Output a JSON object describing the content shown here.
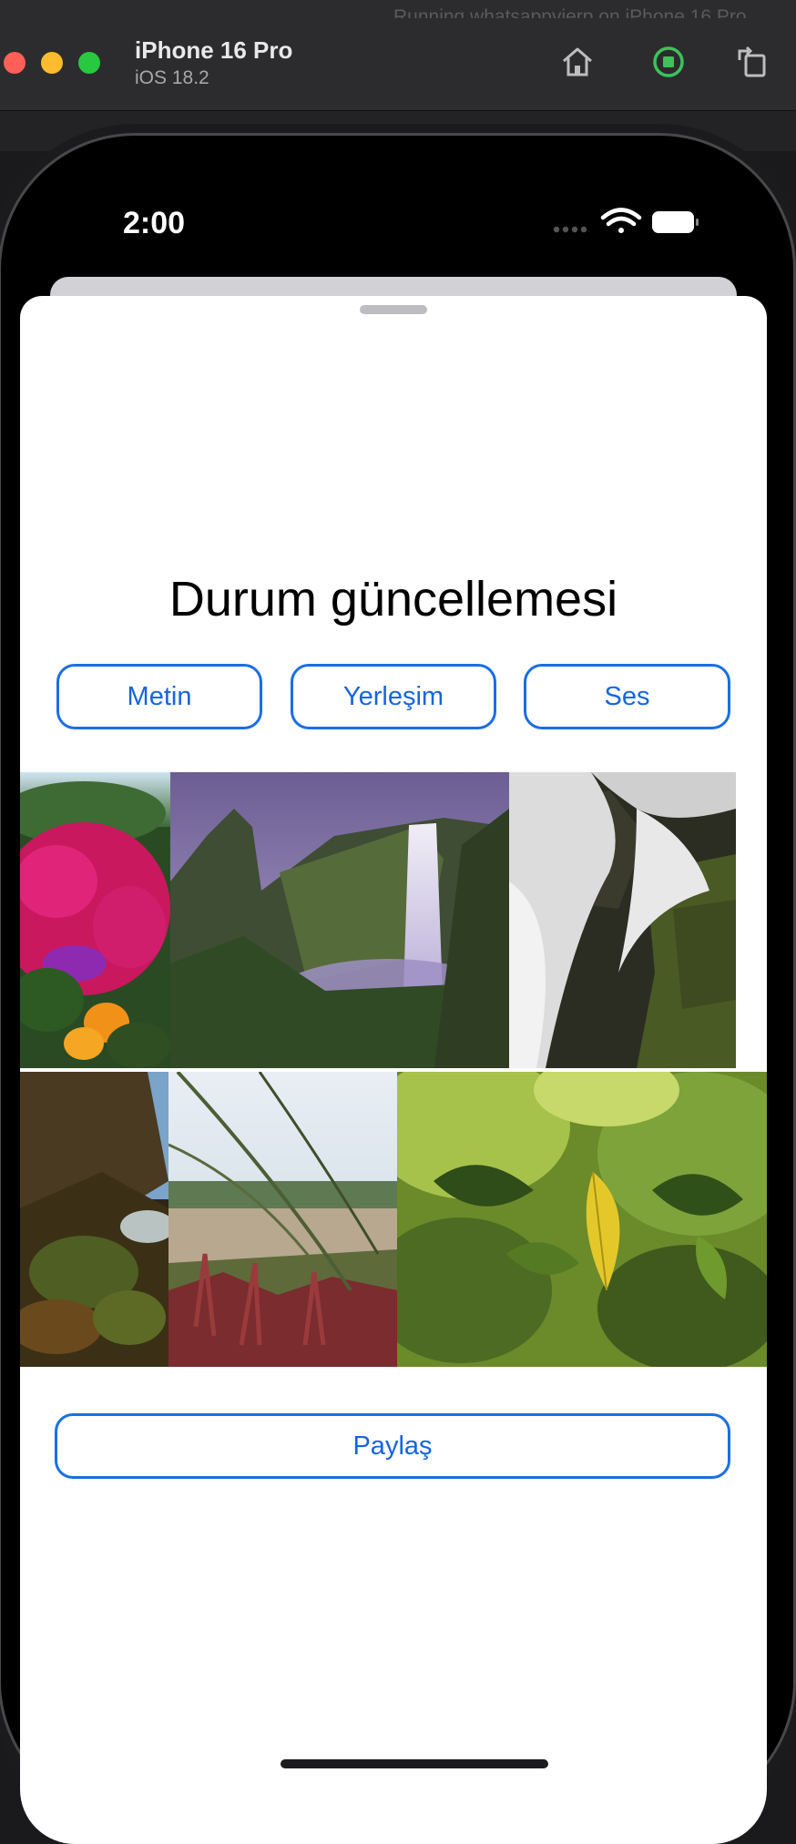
{
  "window": {
    "device_name": "iPhone 16 Pro",
    "os_version": "iOS 18.2",
    "faded_title": "Running whatsappvierp on iPhone 16 Pro"
  },
  "toolbar": {
    "icons": [
      "home-icon",
      "stop-record-icon",
      "rotate-icon"
    ],
    "accent_green": "#3fc15a"
  },
  "status_bar": {
    "time": "2:00",
    "icons": [
      "cellular-dots-icon",
      "wifi-icon",
      "battery-icon"
    ]
  },
  "sheet": {
    "title": "Durum güncellemesi",
    "buttons": [
      {
        "label": "Metin"
      },
      {
        "label": "Yerleşim"
      },
      {
        "label": "Ses"
      }
    ],
    "photos": [
      {
        "name": "flowers-photo"
      },
      {
        "name": "waterfall-photo"
      },
      {
        "name": "stream-photo"
      },
      {
        "name": "cliff-photo"
      },
      {
        "name": "grass-photo"
      },
      {
        "name": "leaves-photo"
      }
    ],
    "share_label": "Paylaş"
  },
  "colors": {
    "accent": "#1565e0"
  }
}
